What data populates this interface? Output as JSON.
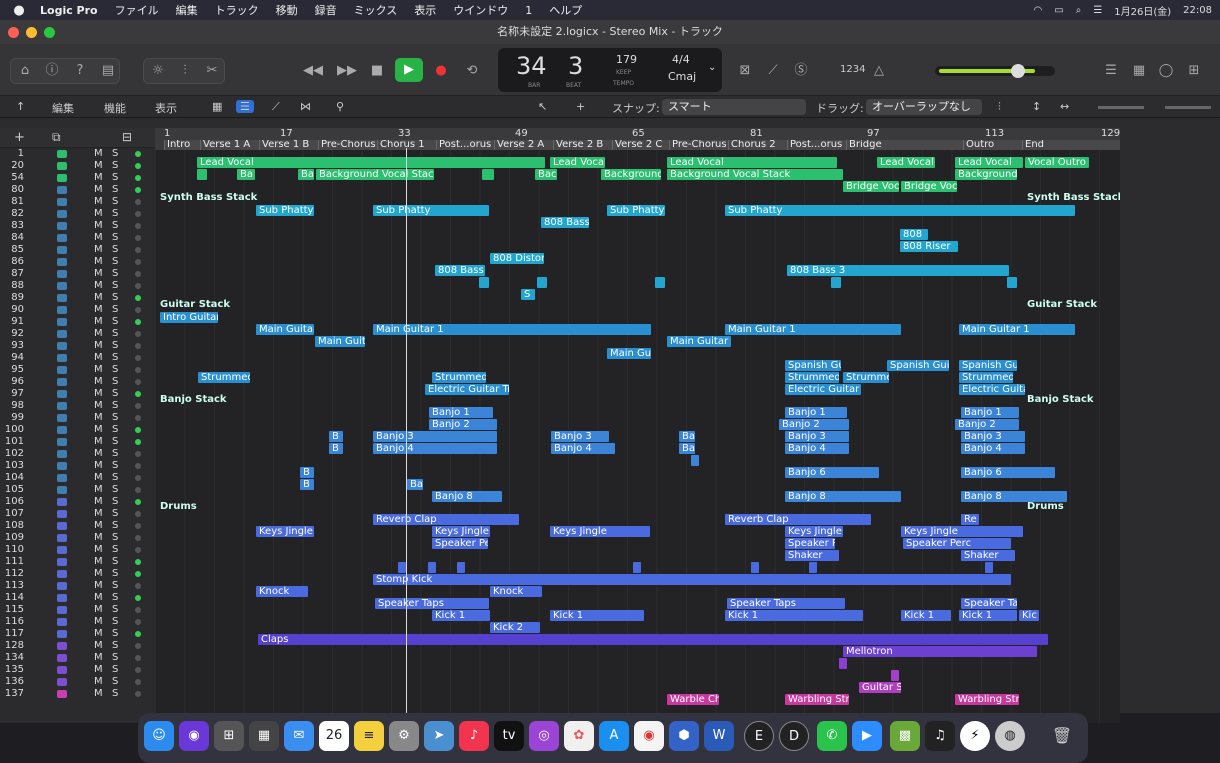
{
  "menubar": {
    "app": "Logic Pro",
    "items": [
      "ファイル",
      "編集",
      "トラック",
      "移動",
      "録音",
      "ミックス",
      "表示",
      "ウインドウ",
      "1",
      "ヘルプ"
    ],
    "date": "1月26日(金)",
    "time": "22:08"
  },
  "window": {
    "title": "名称未設定 2.logicx - Stereo Mix - トラック"
  },
  "lcd": {
    "bar": "34",
    "beat": "3",
    "bar_cap": "BAR",
    "beat_cap": "BEAT",
    "tempo": "179",
    "tempo_mode": "KEEP",
    "tempo_cap": "TEMPO",
    "sig": "4/4",
    "key": "Cmaj",
    "counter": "1234"
  },
  "toolbar": {
    "edit": "編集",
    "func": "機能",
    "view": "表示",
    "snap_label": "スナップ:",
    "snap_value": "スマート",
    "drag_label": "ドラッグ:",
    "drag_value": "オーバーラップなし"
  },
  "ruler": [
    "1",
    "17",
    "33",
    "49",
    "65",
    "81",
    "97",
    "113",
    "129"
  ],
  "markers": [
    "Intro",
    "Verse 1 A",
    "Verse 1 B",
    "Pre-Chorus",
    "Chorus 1",
    "Post...orus",
    "Verse 2 A",
    "Verse 2 B",
    "Verse 2 C",
    "Pre-Chorus",
    "Chorus 2",
    "Post...orus",
    "Bridge",
    "Outro",
    "End"
  ],
  "tracks": [
    "1",
    "20",
    "54",
    "80",
    "81",
    "82",
    "83",
    "84",
    "85",
    "86",
    "87",
    "88",
    "89",
    "90",
    "91",
    "92",
    "93",
    "94",
    "95",
    "96",
    "97",
    "98",
    "99",
    "100",
    "101",
    "102",
    "103",
    "104",
    "105",
    "106",
    "107",
    "108",
    "109",
    "110",
    "111",
    "112",
    "113",
    "114",
    "115",
    "116",
    "117",
    "128",
    "134",
    "135",
    "136",
    "137"
  ],
  "mute": "M",
  "solo": "S",
  "stacks": [
    "Synth Bass Stack",
    "Synth Bass Stack",
    "Guitar Stack",
    "Guitar Stack",
    "Banjo Stack",
    "Banjo Stack",
    "Drums",
    "Drums"
  ],
  "regions": [
    "Lead Vocal",
    "Lead Vocal",
    "Lead Vocal",
    "Lead Vocal",
    "Lead Vocal",
    "Vocal Outro",
    "Ba",
    "Ba",
    "Background Vocal Stack",
    "Bac",
    "Background",
    "Background Vocal Stack",
    "Background",
    "Bridge Voc",
    "Bridge Voc",
    "Sub Phatty",
    "Sub Phatty",
    "Sub Phatty",
    "Sub Phatty",
    "808 Bass",
    "808",
    "808 Riser",
    "808 Distor",
    "808 Bass",
    "808 Bass 3",
    "S",
    "Intro Guitar",
    "Main Guitar",
    "Main Guitar 1",
    "Main Guitar 1",
    "Main Guitar 1",
    "Main Guit",
    "Main Guitar 2",
    "Main Gui",
    "Spanish Gui",
    "Spanish Guit",
    "Spanish Gui",
    "Strummed",
    "Strummed",
    "Strummed",
    "Strumme",
    "Strummed",
    "Electric Guitar Tre",
    "Electric Guitar T",
    "Electric Guita",
    "Banjo 1",
    "Banjo 1",
    "Banjo 1",
    "Banjo 2",
    "Banjo 2",
    "Banjo 2",
    "B",
    "Banjo 3",
    "Banjo 3",
    "Ba",
    "Banjo 3",
    "Banjo 3",
    "B",
    "Banjo 4",
    "Banjo 4",
    "Ba",
    "Banjo 4",
    "Banjo 4",
    "B",
    "Banjo 6",
    "Banjo 6",
    "B",
    "Ba",
    "Banjo 8",
    "Banjo 8",
    "Banjo 8",
    "Reverb Clap",
    "Reverb Clap",
    "Re",
    "Keys Jingle",
    "Keys Jingle",
    "Keys Jingle",
    "Keys Jingle",
    "Keys Jingle",
    "Speaker Pe",
    "Speaker P",
    "Speaker Perc",
    "Shaker",
    "Shaker",
    "Stomp Kick",
    "Knock",
    "Knock",
    "Speaker Taps",
    "Speaker Taps",
    "Speaker Ta",
    "Kick 1",
    "Kick 1",
    "Kick 1",
    "Kick 1",
    "Kick 1",
    "Kic",
    "Kick 2",
    "Claps",
    "Mellotron",
    "Guitar S",
    "Warble Ch",
    "Warbling Stri",
    "Warbling Stri"
  ]
}
